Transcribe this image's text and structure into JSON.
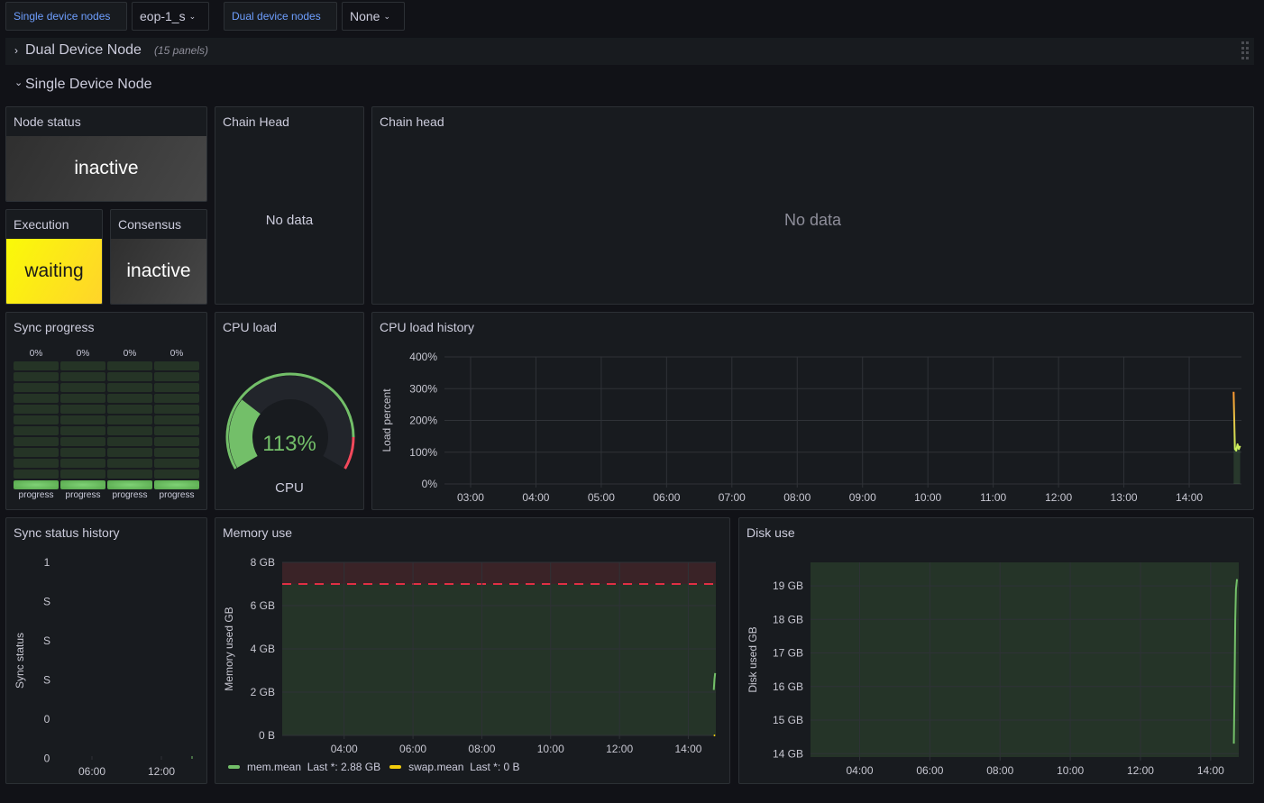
{
  "variables": {
    "single_label": "Single device nodes",
    "single_value": "eop-1_s",
    "dual_label": "Dual device nodes",
    "dual_value": "None"
  },
  "rows": {
    "dual": {
      "title": "Dual Device Node",
      "count": "(15 panels)",
      "chevron": "›"
    },
    "single": {
      "title": "Single Device Node",
      "chevron": "⌄"
    }
  },
  "panels": {
    "node_status": {
      "title": "Node status",
      "value": "inactive"
    },
    "execution": {
      "title": "Execution",
      "value": "waiting"
    },
    "consensus": {
      "title": "Consensus",
      "value": "inactive"
    },
    "chain_head_small": {
      "title": "Chain Head",
      "message": "No data"
    },
    "chain_head_large": {
      "title": "Chain head",
      "message": "No data"
    },
    "sync_progress": {
      "title": "Sync progress",
      "bars": [
        {
          "label": "progress",
          "value_text": "0%",
          "fraction": 0
        },
        {
          "label": "progress",
          "value_text": "0%",
          "fraction": 0
        },
        {
          "label": "progress",
          "value_text": "0%",
          "fraction": 0
        },
        {
          "label": "progress",
          "value_text": "0%",
          "fraction": 0
        }
      ]
    },
    "cpu_load": {
      "title": "CPU load",
      "value_text": "113%",
      "value": 113,
      "max": 400,
      "threshold_red": 350,
      "label": "CPU"
    },
    "sync_status_history": {
      "title": "Sync status history",
      "ylabel": "Sync status",
      "yticks": [
        "1",
        "S",
        "S",
        "S",
        "0",
        "0"
      ],
      "xticks": [
        "06:00",
        "12:00"
      ]
    },
    "legend_memory": [
      {
        "name": "mem.mean",
        "last": "Last *: 2.88 GB",
        "color": "#73bf69"
      },
      {
        "name": "swap.mean",
        "last": "Last *: 0 B",
        "color": "#f2cc0c"
      }
    ]
  },
  "chart_data": [
    {
      "id": "cpu_load_history",
      "title": "CPU load history",
      "type": "line",
      "ylabel": "Load percent",
      "xlabel": "",
      "ylim": [
        0,
        400
      ],
      "yticks": [
        "0%",
        "100%",
        "200%",
        "300%",
        "400%"
      ],
      "xticks": [
        "03:00",
        "04:00",
        "05:00",
        "06:00",
        "07:00",
        "08:00",
        "09:00",
        "10:00",
        "11:00",
        "12:00",
        "13:00",
        "14:00"
      ],
      "xrange_hours": [
        2.6,
        14.8
      ],
      "grid": true,
      "series": [
        {
          "name": "cpu",
          "color": "#fade2a",
          "x": [
            14.68,
            14.7,
            14.72,
            14.74,
            14.76,
            14.78
          ],
          "y": [
            290,
            110,
            105,
            125,
            110,
            120
          ]
        }
      ]
    },
    {
      "id": "memory_use",
      "title": "Memory use",
      "type": "area",
      "ylabel": "Memory used GB",
      "ylim": [
        0,
        8
      ],
      "yticks": [
        "0 B",
        "2 GB",
        "4 GB",
        "6 GB",
        "8 GB"
      ],
      "xticks": [
        "04:00",
        "06:00",
        "08:00",
        "10:00",
        "12:00",
        "14:00"
      ],
      "xrange_hours": [
        2.2,
        14.8
      ],
      "threshold": {
        "value": 7,
        "color": "#e02f44"
      },
      "grid": true,
      "series": [
        {
          "name": "mem.mean",
          "color": "#73bf69",
          "x": [
            14.74,
            14.76,
            14.78
          ],
          "y": [
            2.1,
            2.6,
            2.88
          ]
        },
        {
          "name": "swap.mean",
          "color": "#f2cc0c",
          "x": [
            14.74,
            14.78
          ],
          "y": [
            0,
            0
          ]
        }
      ],
      "legend": "bottom"
    },
    {
      "id": "disk_use",
      "title": "Disk use",
      "type": "line",
      "ylabel": "Disk used GB",
      "ylim": [
        13.9,
        19.7
      ],
      "yticks": [
        "14 GB",
        "15 GB",
        "16 GB",
        "17 GB",
        "18 GB",
        "19 GB"
      ],
      "ytick_values": [
        14,
        15,
        16,
        17,
        18,
        19
      ],
      "xticks": [
        "04:00",
        "06:00",
        "08:00",
        "10:00",
        "12:00",
        "14:00"
      ],
      "xrange_hours": [
        2.6,
        14.8
      ],
      "grid": true,
      "series": [
        {
          "name": "disk",
          "color": "#73bf69",
          "x": [
            14.66,
            14.68,
            14.7,
            14.72,
            14.75
          ],
          "y": [
            14.3,
            16.0,
            18.0,
            18.9,
            19.2
          ]
        }
      ]
    }
  ]
}
